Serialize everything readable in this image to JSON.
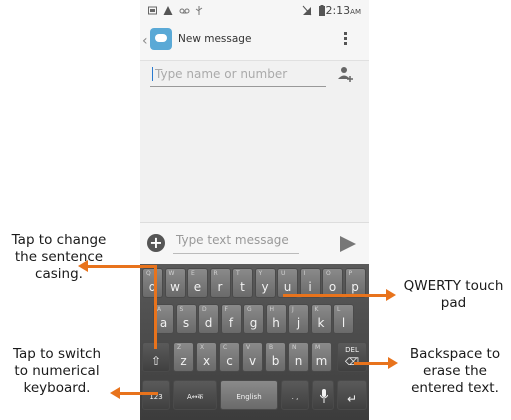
{
  "statusbar": {
    "time": "2:13",
    "ampm": "AM"
  },
  "actionbar": {
    "back_glyph": "‹",
    "title": "New message"
  },
  "recipient": {
    "placeholder": "Type name or number"
  },
  "composer": {
    "placeholder": "Type text message",
    "plus_glyph": "+"
  },
  "keyboard": {
    "row1": [
      [
        "Q",
        "q"
      ],
      [
        "W",
        "w"
      ],
      [
        "E",
        "e"
      ],
      [
        "R",
        "r"
      ],
      [
        "T",
        "t"
      ],
      [
        "Y",
        "y"
      ],
      [
        "U",
        "u"
      ],
      [
        "I",
        "i"
      ],
      [
        "O",
        "o"
      ],
      [
        "P",
        "p"
      ]
    ],
    "row2": [
      [
        "A",
        "a"
      ],
      [
        "S",
        "s"
      ],
      [
        "D",
        "d"
      ],
      [
        "F",
        "f"
      ],
      [
        "G",
        "g"
      ],
      [
        "H",
        "h"
      ],
      [
        "J",
        "j"
      ],
      [
        "K",
        "k"
      ],
      [
        "L",
        "l"
      ]
    ],
    "row3": [
      [
        "Z",
        "z"
      ],
      [
        "X",
        "x"
      ],
      [
        "C",
        "c"
      ],
      [
        "V",
        "v"
      ],
      [
        "B",
        "b"
      ],
      [
        "N",
        "n"
      ],
      [
        "M",
        "m"
      ]
    ],
    "shift_glyph": "⇧",
    "del_label": "DEL",
    "numbers_label": "123",
    "lang_switch_label": "A↔क",
    "space_label": "English",
    "punct_label": ". ,",
    "mic_glyph": "🎤",
    "enter_glyph": "↵"
  },
  "callouts": {
    "sentence_casing": "Tap to change\nthe sentence\ncasing.",
    "numerical": "Tap to switch\nto numerical\nkeyboard.",
    "qwerty": "QWERTY touch\npad",
    "backspace": "Backspace to\nerase the\nentered text."
  },
  "colors": {
    "accent": "#e8731c"
  }
}
